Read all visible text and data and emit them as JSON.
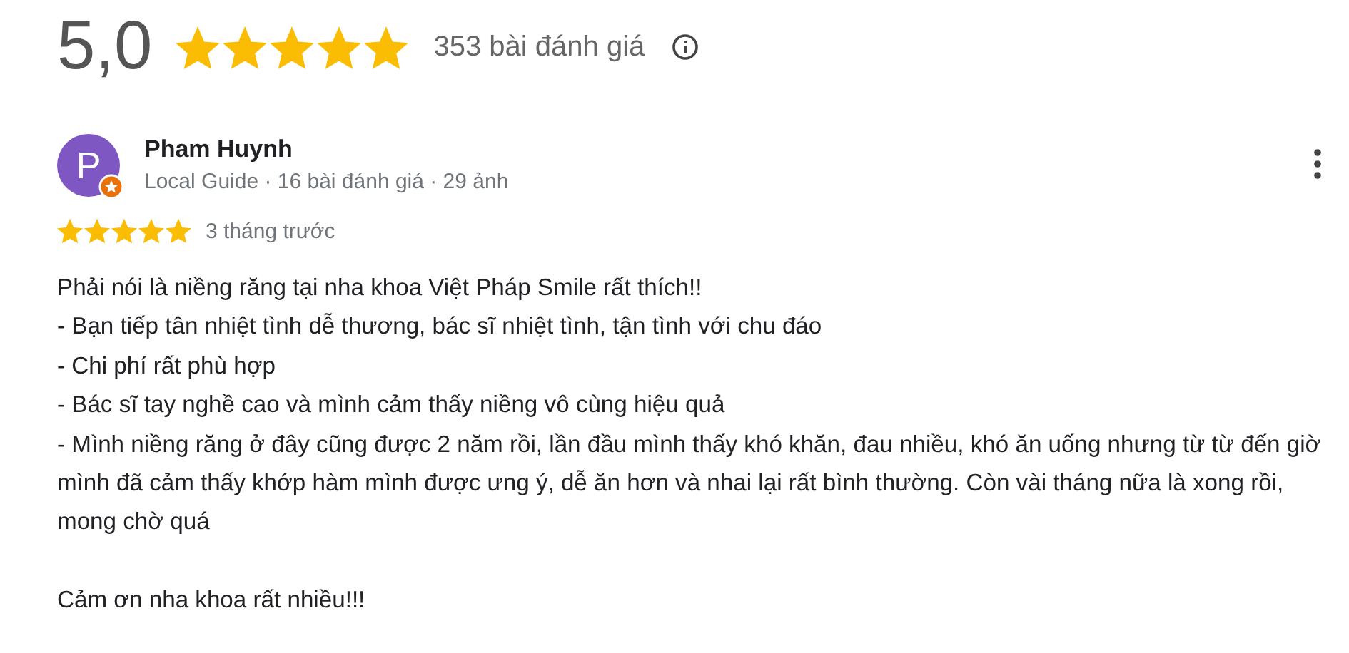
{
  "summary": {
    "score": "5,0",
    "stars": 5,
    "count": "353 bài đánh giá"
  },
  "review": {
    "avatar_letter": "P",
    "local_guide_badge": true,
    "name": "Pham Huynh",
    "meta": "Local Guide · 16 bài đánh giá · 29 ảnh",
    "stars": 5,
    "time": "3 tháng trước",
    "paragraphs": [
      {
        "lines": [
          "Phải nói là niềng răng tại nha khoa Việt Pháp Smile rất thích!!",
          "- Bạn tiếp tân nhiệt tình dễ thương, bác sĩ nhiệt tình, tận tình với chu đáo",
          "- Chi phí rất phù hợp",
          "- Bác sĩ tay nghề cao và mình cảm thấy niềng vô cùng hiệu quả",
          "- Mình niềng răng ở đây cũng được 2 năm rồi, lần đầu mình thấy khó khăn, đau nhiều, khó ăn uống nhưng từ từ đến giờ mình đã cảm thấy khớp hàm mình được ưng ý, dễ ăn hơn và nhai lại rất bình thường. Còn vài tháng nữa là xong rồi, mong chờ quá"
        ]
      },
      {
        "lines": [
          "Cảm ơn nha khoa rất nhiều!!!"
        ]
      }
    ]
  }
}
